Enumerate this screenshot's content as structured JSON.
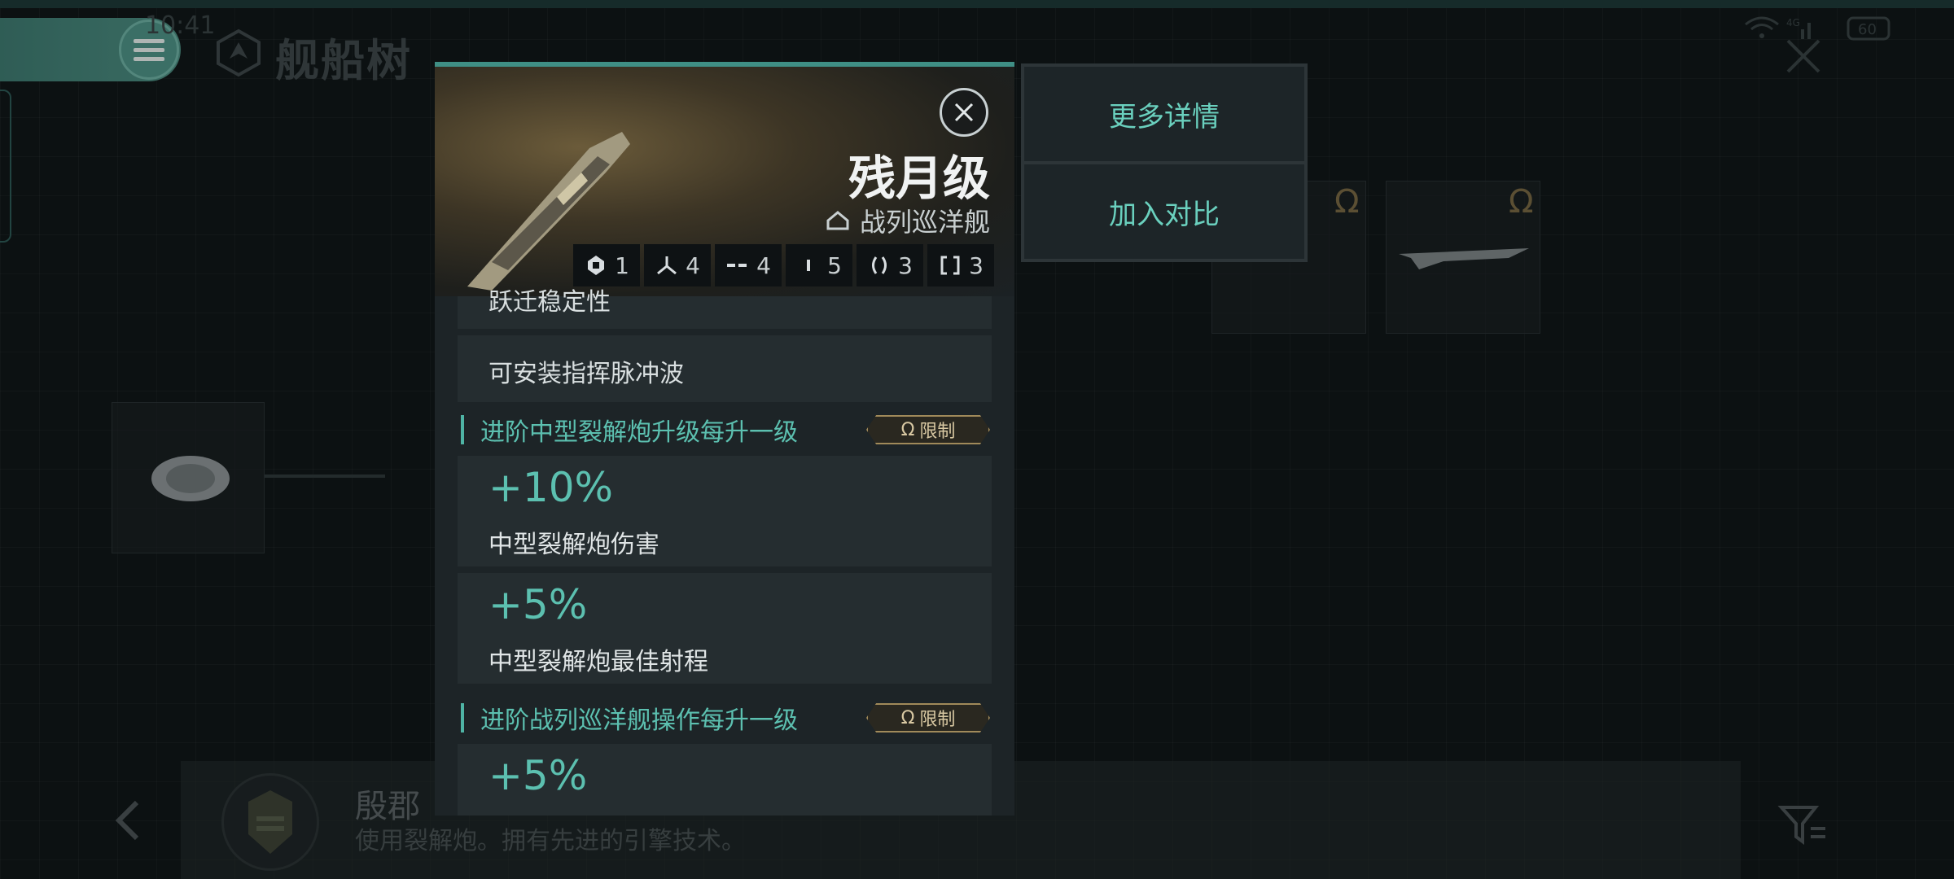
{
  "status_bar": {
    "time": "10:41",
    "battery": "60",
    "signal": "4G"
  },
  "header": {
    "title": "舰船树"
  },
  "modal": {
    "ship_name": "残月级",
    "ship_class": "战列巡洋舰",
    "stats": [
      {
        "icon": "drone-icon",
        "value": "1"
      },
      {
        "icon": "tri-wing-icon",
        "value": "4"
      },
      {
        "icon": "dashes-icon",
        "value": "4"
      },
      {
        "icon": "bar-icon",
        "value": "5"
      },
      {
        "icon": "parens-icon",
        "value": "3"
      },
      {
        "icon": "brackets-icon",
        "value": "3"
      }
    ],
    "cut_row_text": "跃迁稳定性",
    "feature_row": "可安装指挥脉冲波",
    "sections": [
      {
        "title": "进阶中型裂解炮升级每升一级",
        "badge": "限制",
        "bonuses": [
          {
            "value": "+10%",
            "desc": "中型裂解炮伤害"
          },
          {
            "value": "+5%",
            "desc": "中型裂解炮最佳射程"
          }
        ]
      },
      {
        "title": "进阶战列巡洋舰操作每升一级",
        "badge": "限制",
        "bonuses": [
          {
            "value": "+5%",
            "desc": ""
          }
        ]
      }
    ]
  },
  "side_menu": {
    "more_details": "更多详情",
    "add_compare": "加入对比"
  },
  "faction": {
    "name": "殷郡",
    "desc": "使用裂解炮。拥有先进的引擎技术。"
  },
  "colors": {
    "accent": "#5cc0b0",
    "gold": "#a08a5a",
    "panel": "#1d2427"
  }
}
